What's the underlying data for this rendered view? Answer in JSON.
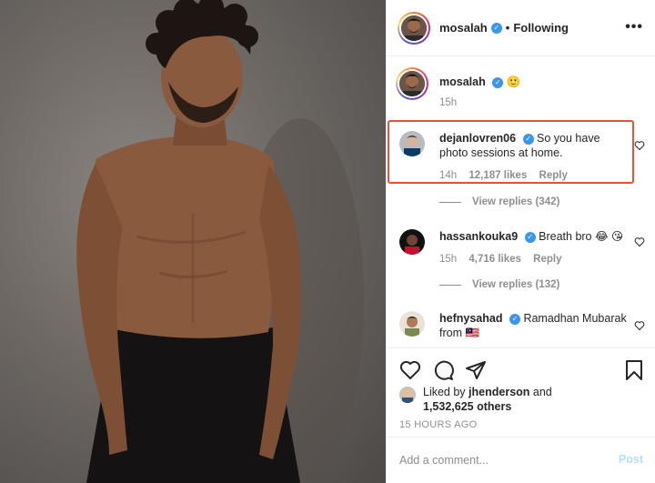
{
  "header": {
    "username": "mosalah",
    "separator": "•",
    "follow_status": "Following",
    "more_icon": "more-horizontal-icon"
  },
  "caption": {
    "username": "mosalah",
    "emoji": "🙂",
    "age": "15h"
  },
  "comments": [
    {
      "username": "dejanlovren06",
      "text": "So you have photo sessions at home.",
      "age": "14h",
      "likes": "12,187 likes",
      "reply": "Reply",
      "view_replies": "View replies (342)"
    },
    {
      "username": "hassankouka9",
      "text": "Breath bro 😂 😘",
      "age": "15h",
      "likes": "4,716 likes",
      "reply": "Reply",
      "view_replies": "View replies (132)"
    },
    {
      "username": "hefnysahad",
      "text": "Ramadhan Mubarak from 🇲🇾"
    }
  ],
  "likes": {
    "prefix": "Liked by",
    "user": "jhenderson",
    "and": "and",
    "others": "1,532,625 others"
  },
  "timestamp": "15 HOURS AGO",
  "add_comment": {
    "placeholder": "Add a comment...",
    "post_label": "Post"
  },
  "colors": {
    "highlight": "#e8523a",
    "verified": "#3897f0",
    "post_disabled": "#b2dffc"
  }
}
